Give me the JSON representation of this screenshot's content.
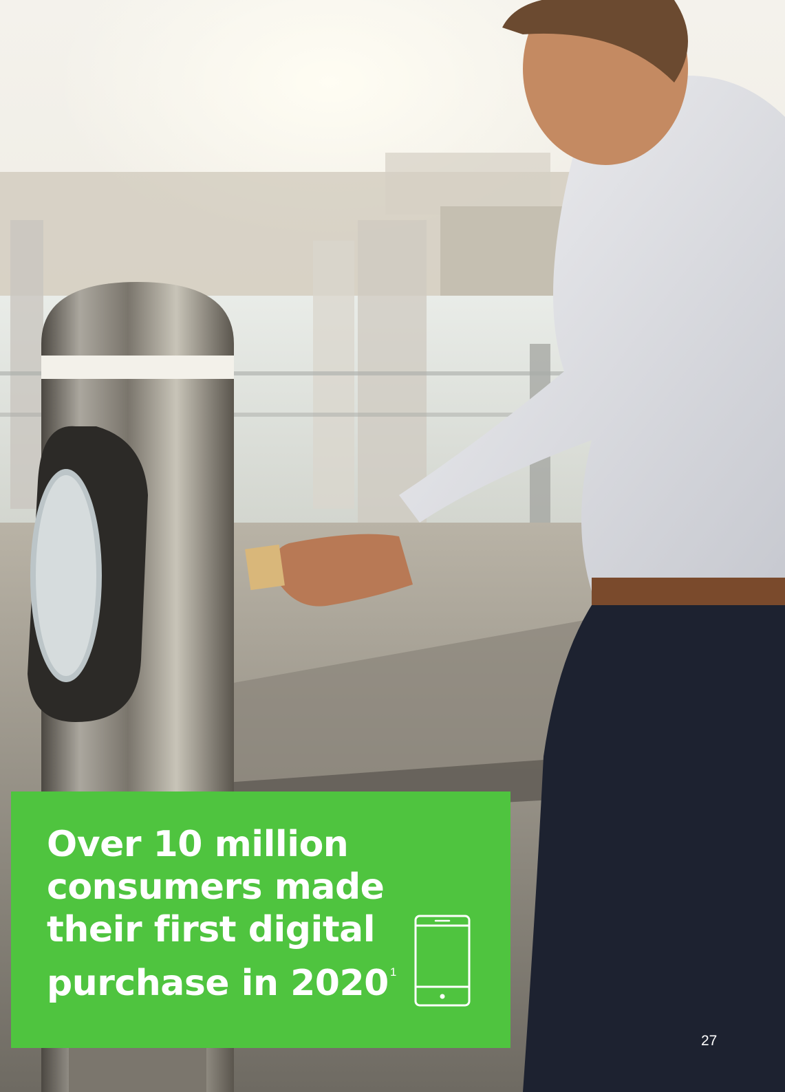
{
  "callout": {
    "headline_lines": [
      "Over 10 million",
      "consumers made",
      "their first digital",
      "purchase in 2020"
    ],
    "footnote_marker": "1",
    "icon": "smartphone-icon",
    "background_color": "#4fc43f"
  },
  "page_number": "27"
}
